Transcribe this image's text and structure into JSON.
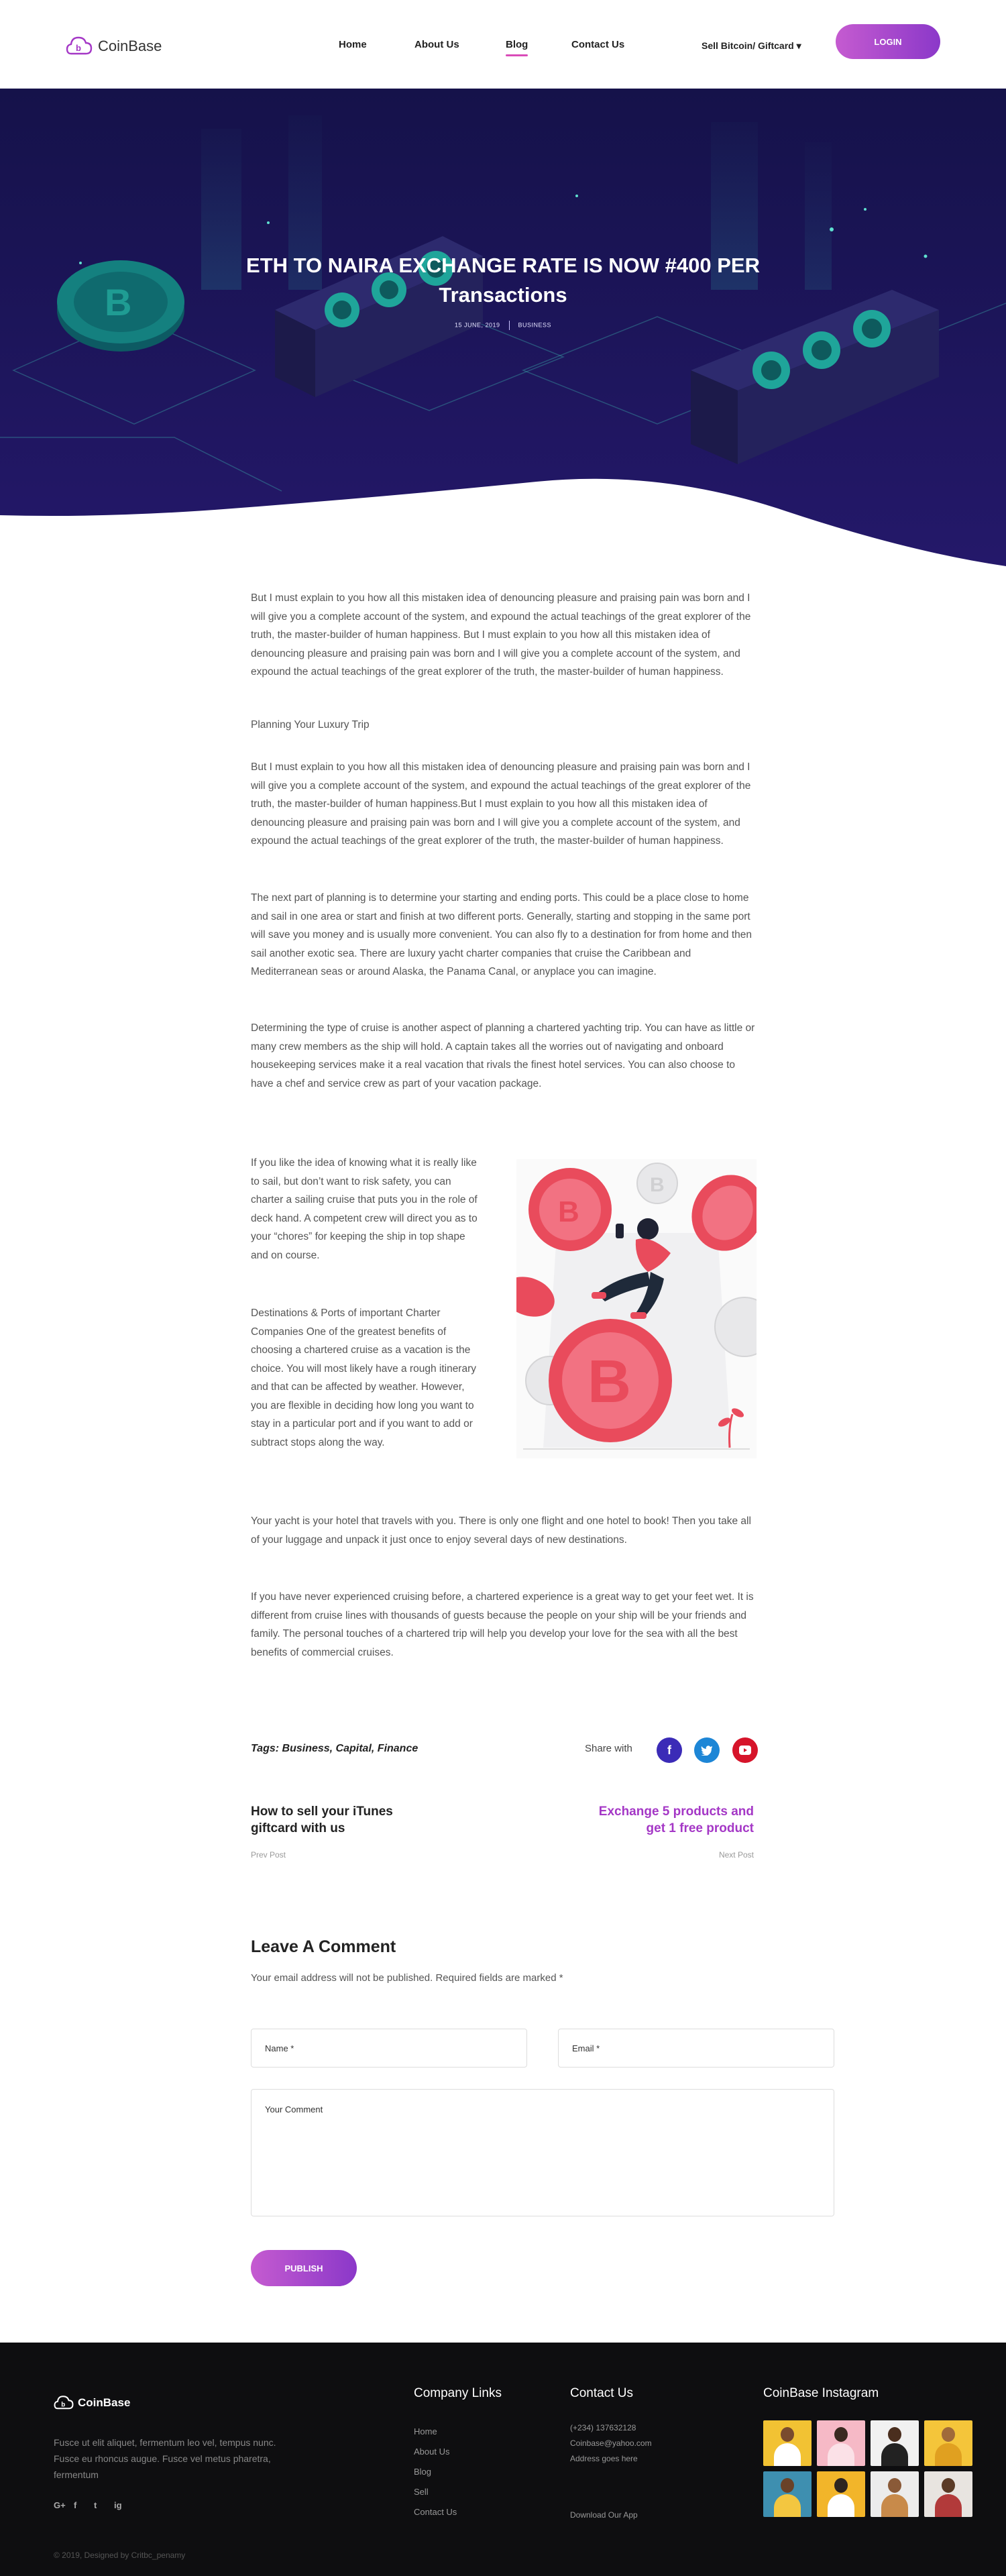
{
  "brand": {
    "name": "CoinBase"
  },
  "nav": {
    "items": [
      {
        "label": "Home",
        "active": false
      },
      {
        "label": "About Us",
        "active": false
      },
      {
        "label": "Blog",
        "active": true
      },
      {
        "label": "Contact Us",
        "active": false
      }
    ],
    "sell_menu": "Sell Bitcoin/ Giftcard ▾",
    "login": "LOGIN"
  },
  "hero": {
    "title_line1": "ETH TO NAIRA EXCHANGE RATE IS NOW #400 PER",
    "title_line2": "Transactions",
    "date": "15 JUNE, 2019",
    "category": "BUSINESS"
  },
  "article": {
    "p1": "But I must explain to you how all this mistaken idea of denouncing pleasure and praising pain was born and I will give you a complete account of the system, and expound the actual teachings of the great explorer of the truth, the master-builder of human happiness. But I must explain to you how all this mistaken idea of denouncing pleasure and praising pain was born and I will give you a complete account of the system, and expound the actual teachings of the great explorer of the truth, the master-builder of human happiness.",
    "subhead": "Planning Your Luxury Trip",
    "p2": "But I must explain to you how all this mistaken idea of denouncing pleasure and praising pain was born and I will give you a complete account of the system, and expound the actual teachings of the great explorer of the truth, the master-builder of human happiness.But I must explain to you how all this mistaken idea of denouncing pleasure and praising pain was born and I will give you a complete account of the system, and expound the actual teachings of the great explorer of the truth, the master-builder of human happiness.",
    "p3": "The next part of planning is to determine your starting and ending ports. This could be a place close to home and sail in one area or start and finish at two different ports. Generally, starting and stopping in the same port will save you money and is usually more convenient. You can also fly to a destination for from home and then sail another exotic sea. There are luxury yacht charter companies that cruise the Caribbean and Mediterranean seas or around Alaska, the Panama Canal, or anyplace you can imagine.",
    "p4": "Determining the type of cruise is another aspect of planning a chartered yachting trip. You can have as little or many crew members as the ship will hold. A captain takes all the worries out of navigating and onboard housekeeping services make it a real vacation that rivals the finest hotel services. You can also choose to have a chef and service crew as part of your vacation package.",
    "c1": "If you like the idea of knowing what it is really like to sail, but don’t want to risk safety, you can charter a sailing cruise that puts you in the role of deck hand. A competent crew will direct you as to your “chores” for keeping the ship in top shape and on course.",
    "c2": "Destinations & Ports of important Charter Companies  One of the greatest benefits of choosing a chartered cruise as a vacation is the choice. You will most likely have a rough itinerary and that can be affected by weather. However, you are flexible in deciding how long you want to stay in a particular port and if you want to add or subtract stops along the way.",
    "p5": "Your yacht is your hotel that travels with you. There is only one flight and one hotel to book! Then you take all of your luggage and unpack it just once to enjoy several days of new destinations.",
    "p6": "If you have never experienced cruising before, a chartered experience is a great way to get your feet wet. It is different from cruise lines with thousands of guests because the people on your ship will be your friends and family. The personal touches of a chartered trip will help you develop your love for the sea with all the best benefits of commercial cruises."
  },
  "tags": "Tags: Business, Capital, Finance",
  "share": {
    "label": "Share with",
    "icons": [
      "facebook-icon",
      "twitter-icon",
      "youtube-icon"
    ]
  },
  "post_nav": {
    "prev_title": "How to sell your iTunes giftcard with us",
    "prev_label": "Prev Post",
    "next_title": "Exchange 5 products and get 1 free product",
    "next_label": "Next Post"
  },
  "comment": {
    "title": "Leave A Comment",
    "note": "Your email address will not be published. Required fields are marked *",
    "name_placeholder": "Name *",
    "email_placeholder": "Email *",
    "comment_placeholder": "Your Comment",
    "publish": "PUBLISH"
  },
  "footer": {
    "brand": "CoinBase",
    "about": "Fusce ut elit aliquet, fermentum leo vel, tempus nunc. Fusce eu rhoncus augue. Fusce vel metus pharetra, fermentum",
    "social": [
      "G+",
      "f",
      "t",
      "ig"
    ],
    "links_heading": "Company Links",
    "links": [
      "Home",
      "About Us",
      "Blog",
      "Sell",
      "Contact Us"
    ],
    "contact_heading": "Contact Us",
    "phone": "(+234) 137632128",
    "email": "Coinbase@yahoo.com",
    "address": "Address goes here",
    "download": "Download Our App",
    "insta_heading": "CoinBase Instagram",
    "copyright": "© 2019, Designed by Critbc_penamy"
  },
  "colors": {
    "accent": "#a437c6",
    "hero_dark": "#1a1551",
    "footer": "#0e0e10"
  }
}
